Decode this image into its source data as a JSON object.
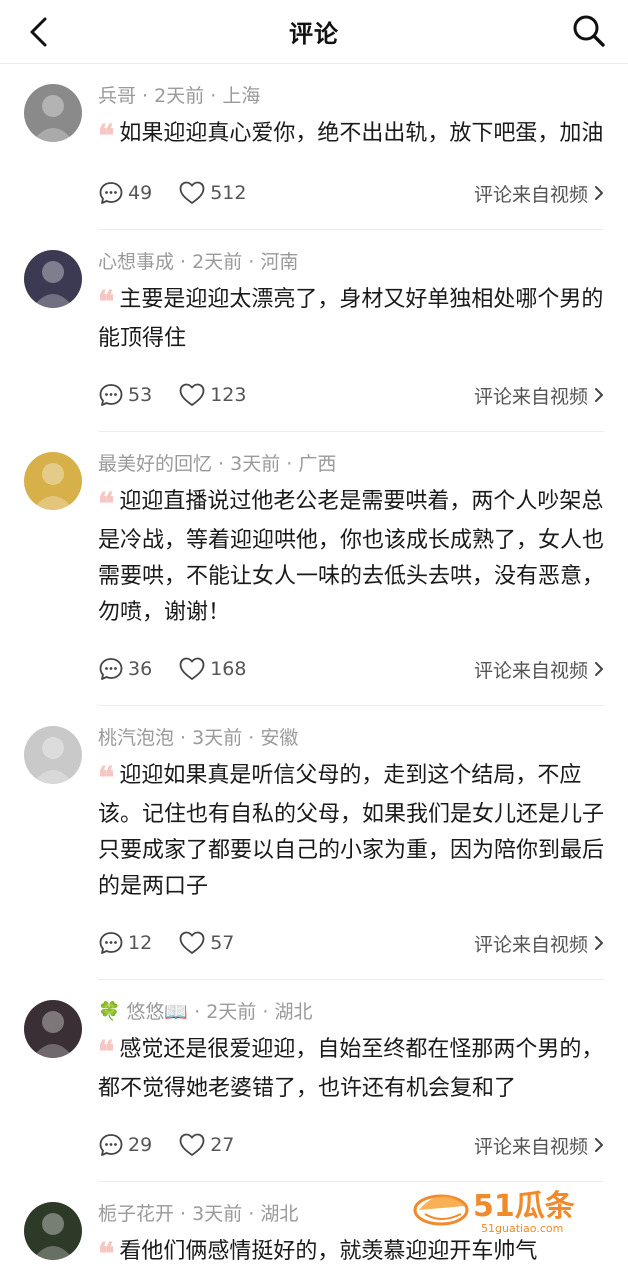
{
  "header": {
    "title": "评论"
  },
  "source_label": "评论来自视频",
  "comments": [
    {
      "user": "兵哥",
      "time": "2天前",
      "location": "上海",
      "prefix": "",
      "text": "如果迎迎真心爱你，绝不出出轨，放下吧蛋，加油",
      "replies": "49",
      "likes": "512",
      "avatar_color": "#8a8a8a"
    },
    {
      "user": "心想事成",
      "time": "2天前",
      "location": "河南",
      "prefix": "",
      "text": "主要是迎迎太漂亮了，身材又好单独相处哪个男的能顶得住",
      "replies": "53",
      "likes": "123",
      "avatar_color": "#3b3a52"
    },
    {
      "user": "最美好的回忆",
      "time": "3天前",
      "location": "广西",
      "prefix": "",
      "text": "迎迎直播说过他老公老是需要哄着，两个人吵架总是冷战，等着迎迎哄他，你也该成长成熟了，女人也需要哄，不能让女人一味的去低头去哄，没有恶意，勿喷，谢谢！",
      "replies": "36",
      "likes": "168",
      "avatar_color": "#d8b04a"
    },
    {
      "user": "桃汽泡泡",
      "time": "3天前",
      "location": "安徽",
      "prefix": "",
      "text": "迎迎如果真是听信父母的，走到这个结局，不应该。记住也有自私的父母，如果我们是女儿还是儿子只要成家了都要以自己的小家为重，因为陪你到最后的是两口子",
      "replies": "12",
      "likes": "57",
      "avatar_color": "#c9c9c9"
    },
    {
      "user": "悠悠📖",
      "time": "2天前",
      "location": "湖北",
      "prefix": "🍀",
      "text": "感觉还是很爱迎迎，自始至终都在怪那两个男的，都不觉得她老婆错了，也许还有机会复和了",
      "replies": "29",
      "likes": "27",
      "avatar_color": "#3a2f34"
    },
    {
      "user": "栀子花开",
      "time": "3天前",
      "location": "湖北",
      "prefix": "",
      "text": "看他们俩感情挺好的，就羡慕迎迎开车帅气",
      "replies": "",
      "likes": "",
      "avatar_color": "#2e3a28"
    }
  ],
  "watermark": {
    "big": "51瓜条",
    "small": "51guatiao.com"
  }
}
